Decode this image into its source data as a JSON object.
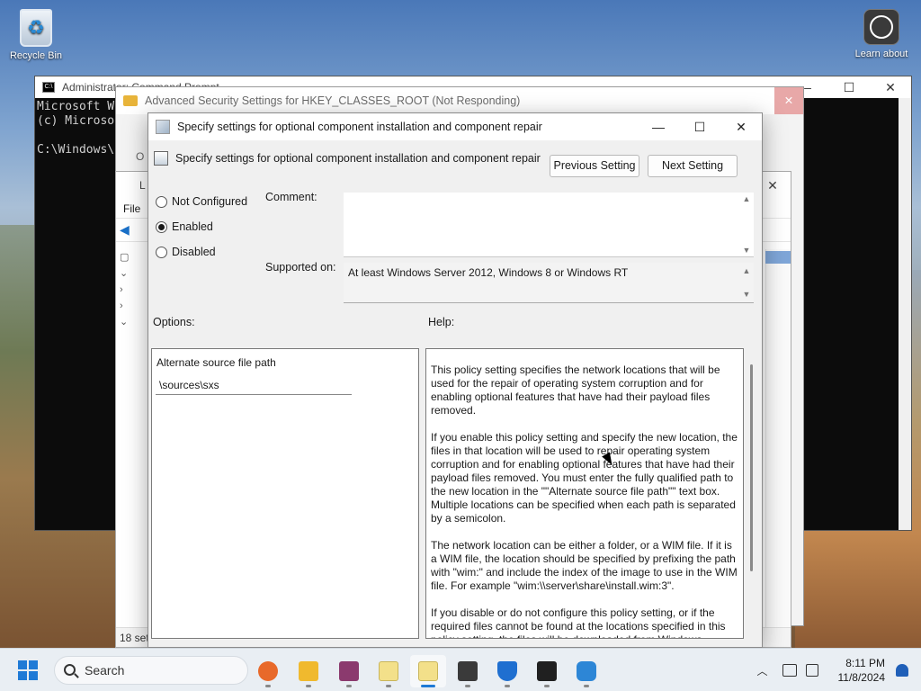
{
  "desktop": {
    "recycle_bin": "Recycle Bin",
    "learn_about": "Learn about"
  },
  "cmd": {
    "title": "Administrator: Command Prompt",
    "lines": [
      "Microsoft W",
      "(c) Microso",
      "",
      "C:\\Windows\\"
    ]
  },
  "adv": {
    "title": "Advanced Security Settings for HKEY_CLASSES_ROOT (Not Responding)",
    "side_text": "O"
  },
  "lgpe": {
    "title_stub": "L",
    "menu_file": "File",
    "status": "18 set"
  },
  "dialog": {
    "title": "Specify settings for optional component installation and component repair",
    "header_title": "Specify settings for optional component installation and component repair",
    "prev_button": "Previous Setting",
    "next_button": "Next Setting",
    "radio_not_configured": "Not Configured",
    "radio_enabled": "Enabled",
    "radio_disabled": "Disabled",
    "selected": "Enabled",
    "comment_label": "Comment:",
    "comment_value": "",
    "supported_label": "Supported on:",
    "supported_value": "At least Windows Server 2012, Windows 8 or Windows RT",
    "options_label": "Options:",
    "help_label": "Help:",
    "option_field_label": "Alternate source file path",
    "option_field_value": "\\sources\\sxs",
    "help_paragraphs": [
      "This policy setting specifies the network locations that will be used for the repair of operating system corruption and for enabling optional features that have had their payload files removed.",
      "If you enable this policy setting and specify the new location, the files in that location will be used to repair operating system corruption and for enabling optional features that have had their payload files removed. You must enter the fully qualified path to the new location in the \"\"Alternate source file path\"\" text box. Multiple locations can be specified when each path is separated by a semicolon.",
      "The network location can be either a folder, or a WIM file. If it is a WIM file, the location should be specified by prefixing the path with \"wim:\" and include the index of the image to use in the WIM file. For example \"wim:\\\\server\\share\\install.wim:3\".",
      "If you disable or do not configure this policy setting, or if the required files cannot be found at the locations specified in this policy setting, the files will be downloaded from Windows Update."
    ]
  },
  "taskbar": {
    "search_placeholder": "Search",
    "time": "8:11 PM",
    "date": "11/8/2024",
    "apps": [
      {
        "name": "firefox",
        "color": "#e8692a"
      },
      {
        "name": "file-explorer",
        "color": "#f0b92e"
      },
      {
        "name": "winrar",
        "color": "#8b3a6e"
      },
      {
        "name": "notepad",
        "color": "#f3e08a"
      },
      {
        "name": "notepad-active",
        "color": "#f3e08a"
      },
      {
        "name": "app-dark",
        "color": "#3a3a3a"
      },
      {
        "name": "defender",
        "color": "#1f6fd0"
      },
      {
        "name": "terminal",
        "color": "#202020"
      },
      {
        "name": "cluster-app",
        "color": "#2d86d6"
      }
    ]
  }
}
